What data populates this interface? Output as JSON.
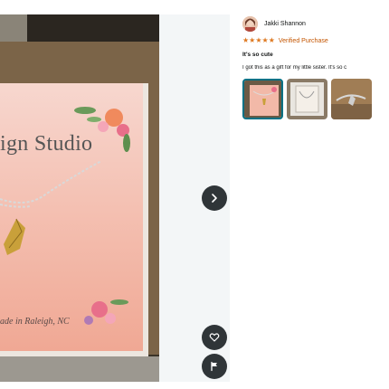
{
  "card": {
    "title": "ign Studio",
    "subtitle": "ade in Raleigh, NC"
  },
  "review": {
    "reviewer_name": "Jakki Shannon",
    "rating": 5,
    "rating_max": 5,
    "badge": "Verified Purchase",
    "title": "It's so cute",
    "body": "I got this as a gift for my little sister. It's so c",
    "thumbnails": [
      {
        "name": "thumbnail-1",
        "selected": true
      },
      {
        "name": "thumbnail-2",
        "selected": false
      },
      {
        "name": "thumbnail-3",
        "selected": false
      }
    ]
  },
  "icons": {
    "next": "chevron-right-icon",
    "favorite": "heart-icon",
    "report": "flag-icon"
  },
  "colors": {
    "star": "#de7921",
    "verified": "#c45500",
    "button": "#2f3538",
    "selected_border": "#007185"
  }
}
